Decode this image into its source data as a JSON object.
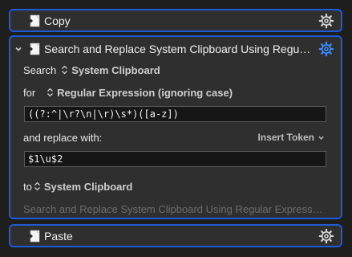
{
  "actions": {
    "copy": {
      "title": "Copy",
      "icon": "clipboard-doc-icon",
      "gear": "gear-icon"
    },
    "main": {
      "title": "Search and Replace System Clipboard Using Regular…",
      "icon": "clipboard-doc-icon",
      "gear": "gear-icon",
      "search_label": "Search",
      "search_target": "System Clipboard",
      "for_label": "for",
      "for_mode": "Regular Expression (ignoring case)",
      "pattern_value": "((?:^|\\r?\\n|\\r)\\s*)([a-z])",
      "replace_label": "and replace with:",
      "insert_token_label": "Insert Token",
      "replace_value": "$1\\u$2",
      "to_label": "to",
      "to_target": "System Clipboard",
      "notes_placeholder": "Search and Replace System Clipboard Using Regular Express…"
    },
    "paste": {
      "title": "Paste",
      "icon": "clipboard-doc-icon",
      "gear": "gear-icon"
    }
  },
  "colors": {
    "selection_border": "#1f5bd6",
    "panel_bg": "#2f2f2f",
    "active_gear": "#3b8cff"
  }
}
